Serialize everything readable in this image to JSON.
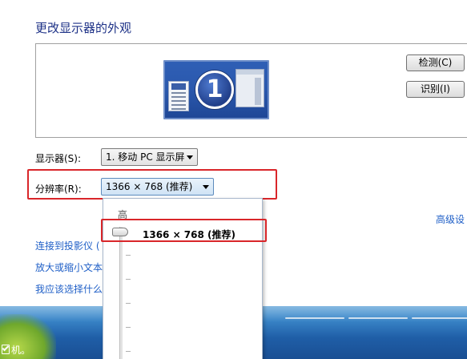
{
  "page": {
    "title": "更改显示器的外观"
  },
  "buttons": {
    "detect": "检测(C)",
    "identify": "识别(I)"
  },
  "monitor": {
    "number": "1"
  },
  "fields": {
    "display_label": "显示器(S):",
    "display_value": "1. 移动 PC 显示屏",
    "resolution_label": "分辨率(R):",
    "resolution_value": "1366 × 768 (推荐)"
  },
  "dropdown": {
    "high_label": "高",
    "option_label": "1366 × 768 (推荐)"
  },
  "links": {
    "advanced": "高级设",
    "projector": "连接到投影仪 (",
    "zoom": "放大或缩小文本",
    "which": "我应该选择什么"
  },
  "taskbar": {
    "label": "机。"
  },
  "colors": {
    "link": "#1f5fc7",
    "highlight_frame": "#d9262a",
    "title": "#1e3287"
  }
}
